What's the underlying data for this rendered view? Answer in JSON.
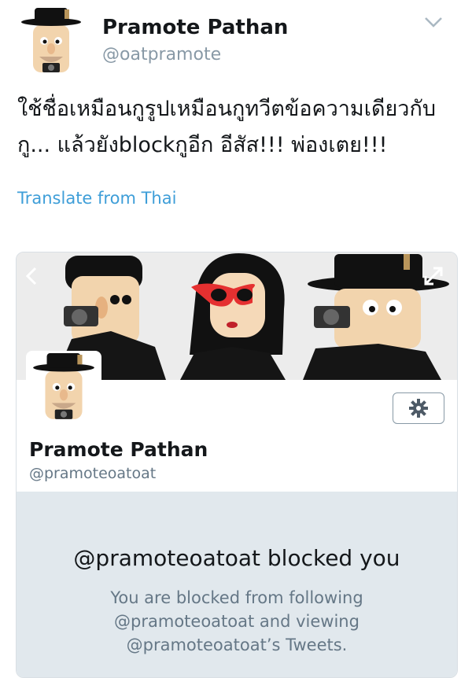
{
  "tweet": {
    "author_name": "Pramote Pathan",
    "author_handle": "@oatpramote",
    "text": "ใช้ชื่อเหมือนกูรูปเหมือนกูทวีตข้อความเดียวกับกู... แล้วยังblockกูอีก อีสัส!!! พ่องเตย!!!",
    "translate_label": "Translate from Thai"
  },
  "profile_card": {
    "name": "Pramote Pathan",
    "handle": "@pramoteoatoat",
    "blocked_title": "@pramoteoatoat blocked you",
    "blocked_description": "You are blocked from following @pramoteoatoat and viewing @pramoteoatoat’s Tweets."
  },
  "icons": {
    "menu": "chevron-down-icon",
    "previous": "chevron-left-icon",
    "expand": "expand-icon",
    "settings": "gear-icon"
  },
  "colors": {
    "link": "#3e9ed8",
    "muted": "#8899a6",
    "blocked_bg": "#e1e8ed"
  }
}
